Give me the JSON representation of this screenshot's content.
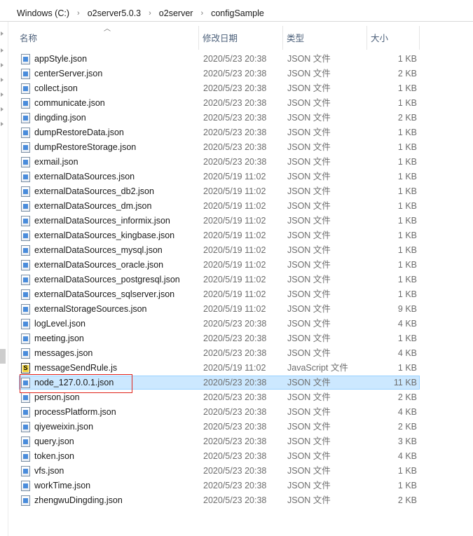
{
  "breadcrumb": {
    "items": [
      "Windows (C:)",
      "o2server5.0.3",
      "o2server",
      "configSample"
    ],
    "separator": "›"
  },
  "columns": {
    "name": "名称",
    "modified": "修改日期",
    "type": "类型",
    "size": "大小"
  },
  "files": [
    {
      "name": "appStyle.json",
      "modified": "2020/5/23 20:38",
      "type": "JSON 文件",
      "size": "1 KB"
    },
    {
      "name": "centerServer.json",
      "modified": "2020/5/23 20:38",
      "type": "JSON 文件",
      "size": "2 KB"
    },
    {
      "name": "collect.json",
      "modified": "2020/5/23 20:38",
      "type": "JSON 文件",
      "size": "1 KB"
    },
    {
      "name": "communicate.json",
      "modified": "2020/5/23 20:38",
      "type": "JSON 文件",
      "size": "1 KB"
    },
    {
      "name": "dingding.json",
      "modified": "2020/5/23 20:38",
      "type": "JSON 文件",
      "size": "2 KB"
    },
    {
      "name": "dumpRestoreData.json",
      "modified": "2020/5/23 20:38",
      "type": "JSON 文件",
      "size": "1 KB"
    },
    {
      "name": "dumpRestoreStorage.json",
      "modified": "2020/5/23 20:38",
      "type": "JSON 文件",
      "size": "1 KB"
    },
    {
      "name": "exmail.json",
      "modified": "2020/5/23 20:38",
      "type": "JSON 文件",
      "size": "1 KB"
    },
    {
      "name": "externalDataSources.json",
      "modified": "2020/5/19 11:02",
      "type": "JSON 文件",
      "size": "1 KB"
    },
    {
      "name": "externalDataSources_db2.json",
      "modified": "2020/5/19 11:02",
      "type": "JSON 文件",
      "size": "1 KB"
    },
    {
      "name": "externalDataSources_dm.json",
      "modified": "2020/5/19 11:02",
      "type": "JSON 文件",
      "size": "1 KB"
    },
    {
      "name": "externalDataSources_informix.json",
      "modified": "2020/5/19 11:02",
      "type": "JSON 文件",
      "size": "1 KB"
    },
    {
      "name": "externalDataSources_kingbase.json",
      "modified": "2020/5/19 11:02",
      "type": "JSON 文件",
      "size": "1 KB"
    },
    {
      "name": "externalDataSources_mysql.json",
      "modified": "2020/5/19 11:02",
      "type": "JSON 文件",
      "size": "1 KB"
    },
    {
      "name": "externalDataSources_oracle.json",
      "modified": "2020/5/19 11:02",
      "type": "JSON 文件",
      "size": "1 KB"
    },
    {
      "name": "externalDataSources_postgresql.json",
      "modified": "2020/5/19 11:02",
      "type": "JSON 文件",
      "size": "1 KB"
    },
    {
      "name": "externalDataSources_sqlserver.json",
      "modified": "2020/5/19 11:02",
      "type": "JSON 文件",
      "size": "1 KB"
    },
    {
      "name": "externalStorageSources.json",
      "modified": "2020/5/19 11:02",
      "type": "JSON 文件",
      "size": "9 KB"
    },
    {
      "name": "logLevel.json",
      "modified": "2020/5/23 20:38",
      "type": "JSON 文件",
      "size": "4 KB"
    },
    {
      "name": "meeting.json",
      "modified": "2020/5/23 20:38",
      "type": "JSON 文件",
      "size": "1 KB"
    },
    {
      "name": "messages.json",
      "modified": "2020/5/23 20:38",
      "type": "JSON 文件",
      "size": "4 KB"
    },
    {
      "name": "messageSendRule.js",
      "modified": "2020/5/19 11:02",
      "type": "JavaScript 文件",
      "size": "1 KB",
      "icon": "javascript-file-icon"
    },
    {
      "name": "node_127.0.0.1.json",
      "modified": "2020/5/23 20:38",
      "type": "JSON 文件",
      "size": "11 KB",
      "selected": true
    },
    {
      "name": "person.json",
      "modified": "2020/5/23 20:38",
      "type": "JSON 文件",
      "size": "2 KB"
    },
    {
      "name": "processPlatform.json",
      "modified": "2020/5/23 20:38",
      "type": "JSON 文件",
      "size": "4 KB"
    },
    {
      "name": "qiyeweixin.json",
      "modified": "2020/5/23 20:38",
      "type": "JSON 文件",
      "size": "2 KB"
    },
    {
      "name": "query.json",
      "modified": "2020/5/23 20:38",
      "type": "JSON 文件",
      "size": "3 KB"
    },
    {
      "name": "token.json",
      "modified": "2020/5/23 20:38",
      "type": "JSON 文件",
      "size": "4 KB"
    },
    {
      "name": "vfs.json",
      "modified": "2020/5/23 20:38",
      "type": "JSON 文件",
      "size": "1 KB"
    },
    {
      "name": "workTime.json",
      "modified": "2020/5/23 20:38",
      "type": "JSON 文件",
      "size": "1 KB"
    },
    {
      "name": "zhengwuDingding.json",
      "modified": "2020/5/23 20:38",
      "type": "JSON 文件",
      "size": "2 KB"
    }
  ],
  "colors": {
    "selection": "#cce8ff",
    "selection_border": "#99d1ff",
    "highlight_box": "#e0231a"
  }
}
